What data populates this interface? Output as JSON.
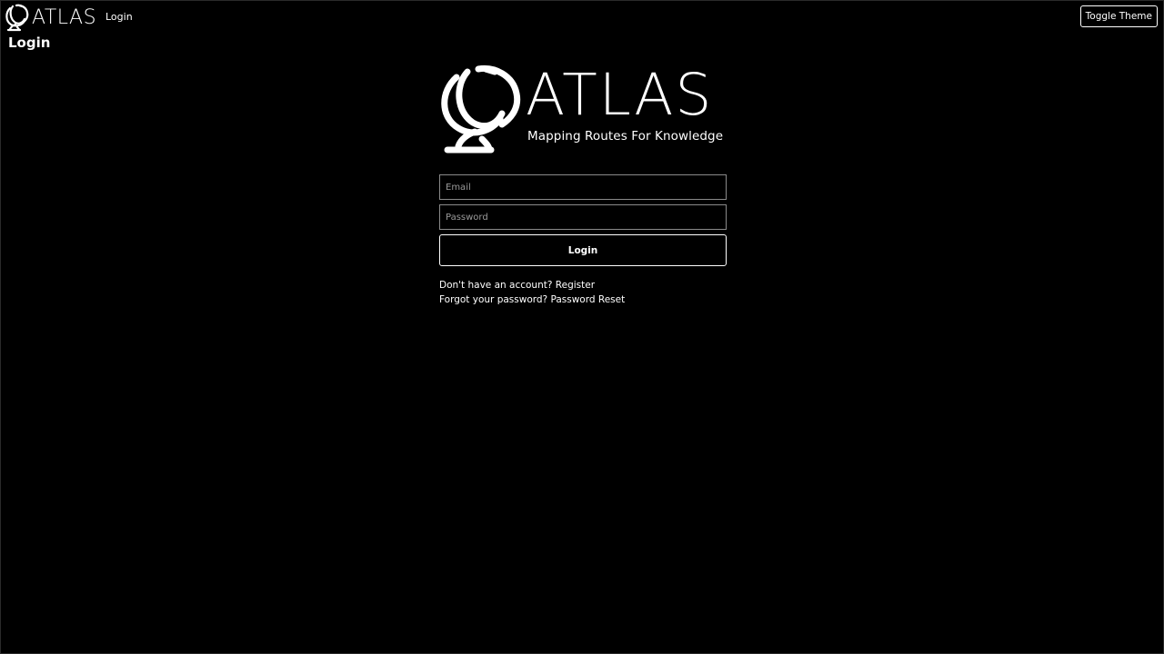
{
  "nav": {
    "brand": "ATLAS",
    "login_link": "Login",
    "toggle_theme": "Toggle Theme"
  },
  "page": {
    "title": "Login"
  },
  "hero": {
    "wordmark": "ATLAS",
    "tagline": "Mapping Routes For Knowledge",
    "icon": "globe-icon"
  },
  "form": {
    "email_placeholder": "Email",
    "email_value": "",
    "password_placeholder": "Password",
    "password_value": "",
    "submit_label": "Login"
  },
  "links": {
    "register_prompt": "Don't have an account?",
    "register_link": "Register",
    "reset_prompt": "Forgot your password?",
    "reset_link": "Password Reset"
  },
  "colors": {
    "background": "#000000",
    "foreground": "#ffffff",
    "input_border": "#8a8a8a"
  }
}
